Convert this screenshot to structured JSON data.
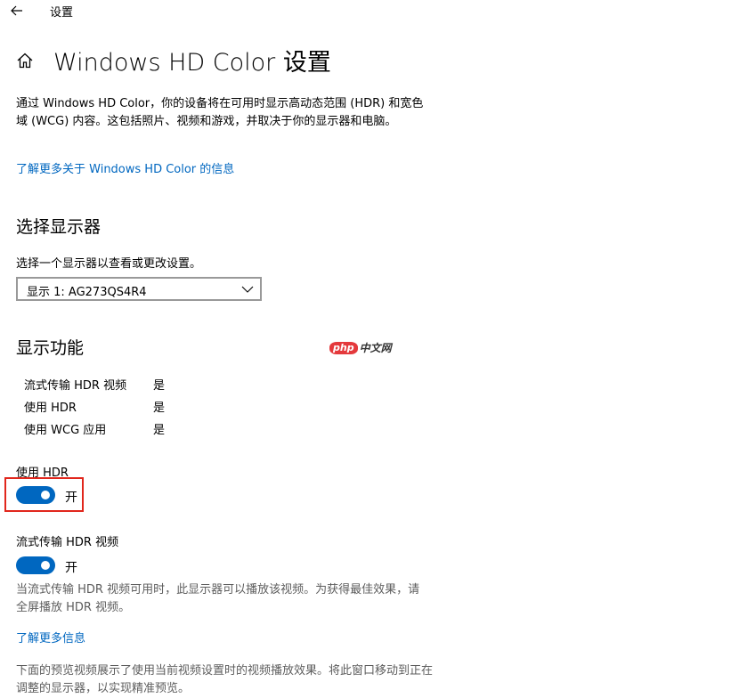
{
  "header": {
    "app_title": "设置",
    "back_icon": "arrow-left-icon"
  },
  "page": {
    "home_icon": "home-icon",
    "title": "Windows HD Color 设置",
    "description": "通过 Windows HD Color，你的设备将在可用时显示高动态范围 (HDR) 和宽色域 (WCG) 内容。这包括照片、视频和游戏，并取决于你的显示器和电脑。",
    "learn_more_link": "了解更多关于 Windows HD Color 的信息"
  },
  "choose_display": {
    "heading": "选择显示器",
    "label": "选择一个显示器以查看或更改设置。",
    "selected": "显示 1: AG273QS4R4"
  },
  "capabilities": {
    "heading": "显示功能",
    "rows": [
      {
        "name": "流式传输 HDR 视频",
        "value": "是"
      },
      {
        "name": "使用 HDR",
        "value": "是"
      },
      {
        "name": "使用 WCG 应用",
        "value": "是"
      }
    ]
  },
  "use_hdr": {
    "label": "使用 HDR",
    "state_text": "开",
    "on": true
  },
  "stream_hdr": {
    "label": "流式传输 HDR 视频",
    "state_text": "开",
    "on": true,
    "note": "当流式传输 HDR 视频可用时，此显示器可以播放该视频。为获得最佳效果，请全屏播放 HDR 视频。",
    "learn_more_link": "了解更多信息"
  },
  "preview": {
    "note": "下面的预览视频展示了使用当前视频设置时的视频播放效果。将此窗口移动到正在调整的显示器，以实现精准预览。"
  },
  "watermark": {
    "logo_text": "php",
    "text": "中文网"
  },
  "colors": {
    "accent": "#0067c0",
    "highlight": "#e1261c"
  }
}
